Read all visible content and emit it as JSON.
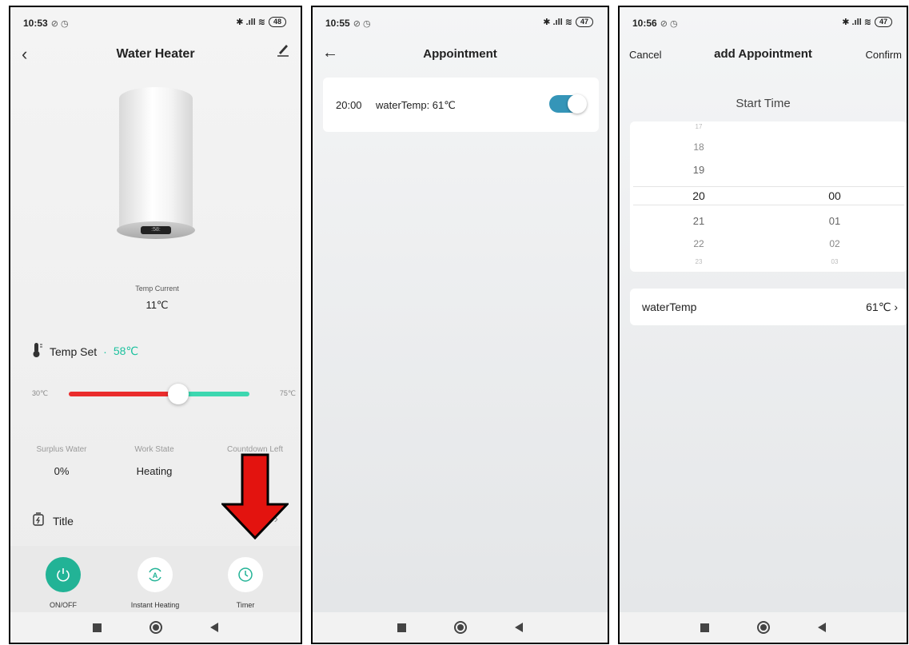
{
  "panel1": {
    "status": {
      "time": "10:53",
      "battery": "48"
    },
    "title": "Water Heater",
    "heater_display": ":58:",
    "temp_current_label": "Temp Current",
    "temp_current_value": "11℃",
    "temp_set_label": "Temp Set",
    "temp_set_sep": "·",
    "temp_set_value": "58℃",
    "slider": {
      "min_label": "30℃",
      "max_label": "75℃",
      "level_fraction": 0.6
    },
    "stats": [
      {
        "label": "Surplus Water",
        "value": "0%"
      },
      {
        "label": "Work State",
        "value": "Heating"
      },
      {
        "label": "Countdown Left",
        "value": ""
      }
    ],
    "title_row_label": "Title",
    "actions": [
      {
        "label": "ON/OFF"
      },
      {
        "label": "Instant Heating"
      },
      {
        "label": "Timer"
      }
    ]
  },
  "panel2": {
    "status": {
      "time": "10:55",
      "battery": "47"
    },
    "title": "Appointment",
    "appointment": {
      "time": "20:00",
      "desc": "waterTemp: 61℃",
      "enabled": true
    }
  },
  "panel3": {
    "status": {
      "time": "10:56",
      "battery": "47"
    },
    "cancel": "Cancel",
    "title": "add Appointment",
    "confirm": "Confirm",
    "start_time_label": "Start Time",
    "hours": [
      "17",
      "18",
      "19",
      "20",
      "21",
      "22",
      "23"
    ],
    "minutes": [
      "00",
      "01",
      "02",
      "03"
    ],
    "field_label": "waterTemp",
    "field_value": "61℃"
  },
  "colors": {
    "accent_green": "#22b396",
    "toggle_blue": "#3595b8",
    "slider_red": "#ea2c2c",
    "slider_green": "#3dd7b0",
    "arrow_red": "#e3130f"
  }
}
